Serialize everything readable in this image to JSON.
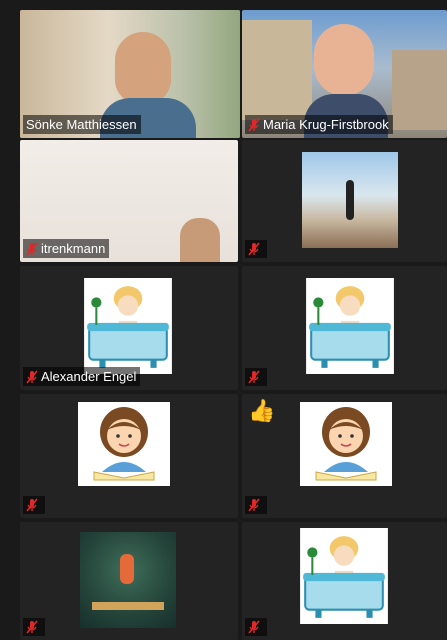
{
  "participants": [
    {
      "name": "Sönke Matthiessen",
      "muted": false,
      "active": true
    },
    {
      "name": "Maria Krug-Firstbrook",
      "muted": true
    },
    {
      "name": "itrenkmann",
      "muted": true
    },
    {
      "name": "",
      "muted": true,
      "avatar": "beach-photo"
    },
    {
      "name": "Alexander Engel",
      "muted": true,
      "avatar": "cartoon-bathtub"
    },
    {
      "name": "",
      "muted": true,
      "avatar": "cartoon-bathtub"
    },
    {
      "name": "",
      "muted": true,
      "avatar": "cartoon-reading-girl"
    },
    {
      "name": "",
      "muted": true,
      "avatar": "cartoon-reading-girl",
      "reaction": "thumbs-up"
    },
    {
      "name": "",
      "muted": true,
      "avatar": "hiker-illustration"
    },
    {
      "name": "",
      "muted": true,
      "avatar": "cartoon-bathtub"
    }
  ],
  "colors": {
    "active_border": "#c8e36a",
    "mic_muted": "#e02828",
    "tile_bg": "#232323"
  }
}
